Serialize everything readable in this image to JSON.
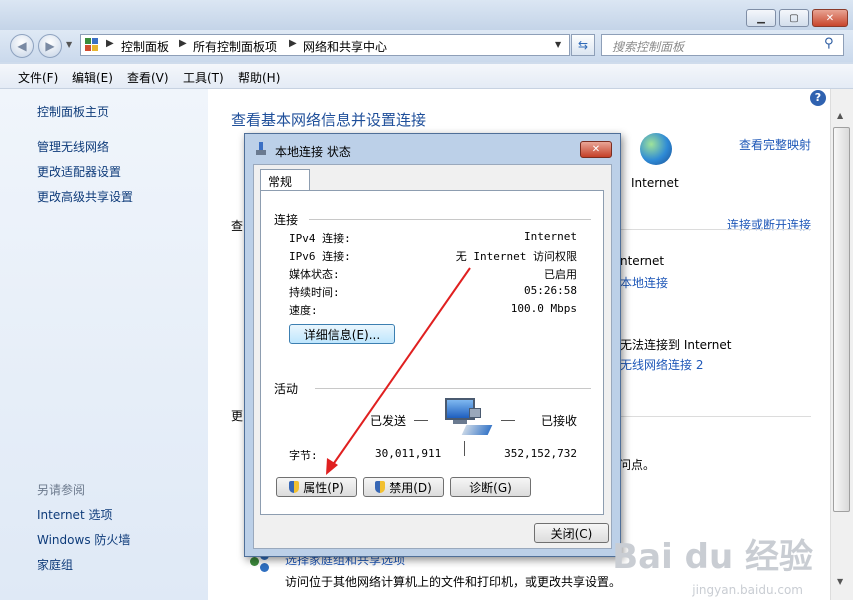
{
  "window": {
    "minimize": "▁",
    "maximize": "▢",
    "close": "✕"
  },
  "navigation": {
    "back": "◀",
    "forward": "▶",
    "breadcrumb": [
      "控制面板",
      "所有控制面板项",
      "网络和共享中心"
    ],
    "search_placeholder": "搜索控制面板"
  },
  "menu": [
    "文件(F)",
    "编辑(E)",
    "查看(V)",
    "工具(T)",
    "帮助(H)"
  ],
  "sidebar": {
    "items": [
      "控制面板主页",
      "管理无线网络",
      "更改适配器设置",
      "更改高级共享设置"
    ],
    "see_also_header": "另请参阅",
    "see_also": [
      "Internet 选项",
      "Windows 防火墙",
      "家庭组"
    ]
  },
  "main": {
    "heading": "查看基本网络信息并设置连接",
    "view_full_map": "查看完整映射",
    "internet_label": "Internet",
    "connect_disconnect": "连接或断开连接",
    "partial_texts": [
      "查",
      "更",
      "nternet",
      "本地连接",
      "无法连接到 Internet",
      "无线网络连接 2",
      "问点。"
    ],
    "homegroup_link": "选择家庭组和共享选项",
    "homegroup_desc": "访问位于其他网络计算机上的文件和打印机，或更改共享设置。"
  },
  "dialog": {
    "title": "本地连接 状态",
    "tab": "常规",
    "connection_header": "连接",
    "rows": [
      {
        "label": "IPv4 连接:",
        "value": "Internet"
      },
      {
        "label": "IPv6 连接:",
        "value": "无 Internet 访问权限"
      },
      {
        "label": "媒体状态:",
        "value": "已启用"
      },
      {
        "label": "持续时间:",
        "value": "05:26:58"
      },
      {
        "label": "速度:",
        "value": "100.0 Mbps"
      }
    ],
    "details_button": "详细信息(E)...",
    "activity_header": "活动",
    "sent_label": "已发送",
    "received_label": "已接收",
    "bytes_label": "字节:",
    "bytes_sent": "30,011,911",
    "bytes_received": "352,152,732",
    "properties_button": "属性(P)",
    "disable_button": "禁用(D)",
    "diagnose_button": "诊断(G)",
    "close_button": "关闭(C)",
    "close_x": "✕"
  },
  "watermark": {
    "brand": "Bai du 经验",
    "url": "jingyan.baidu.com"
  },
  "colors": {
    "link": "#1f58b8",
    "annotation_arrow": "#e02020"
  }
}
